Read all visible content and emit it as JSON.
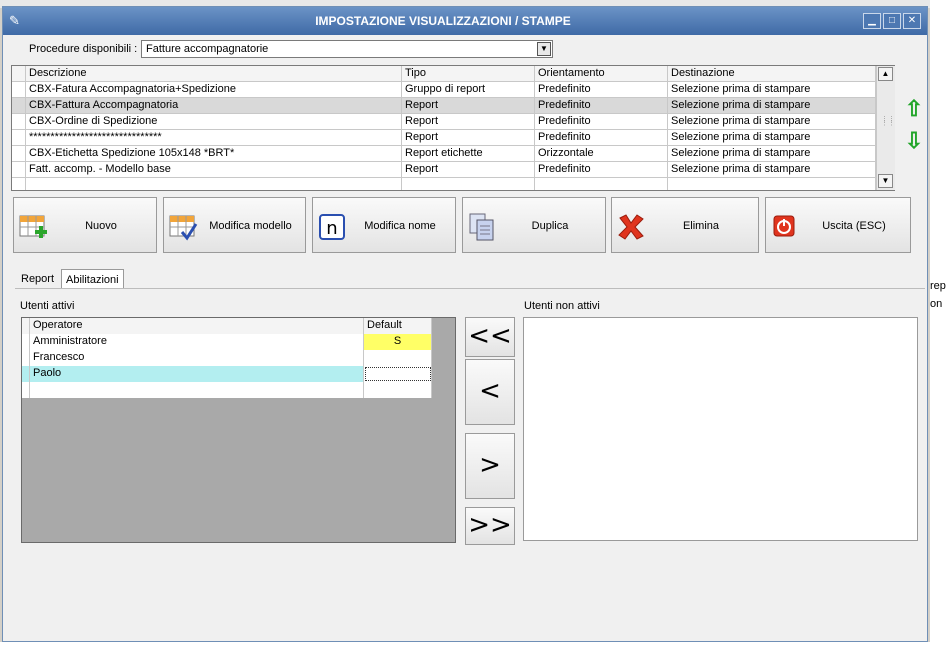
{
  "window": {
    "title": "IMPOSTAZIONE VISUALIZZAZIONI / STAMPE"
  },
  "procedure": {
    "label": "Procedure disponibili :",
    "value": "Fatture accompagnatorie"
  },
  "reports": {
    "columns": [
      "Descrizione",
      "Tipo",
      "Orientamento",
      "Destinazione"
    ],
    "rows": [
      [
        "CBX-Fatura Accompagnatoria+Spedizione",
        "Gruppo di report",
        "Predefinito",
        "Selezione prima di stampare"
      ],
      [
        "CBX-Fattura Accompagnatoria",
        "Report",
        "Predefinito",
        "Selezione prima di stampare"
      ],
      [
        "CBX-Ordine di Spedizione",
        "Report",
        "Predefinito",
        "Selezione prima di stampare"
      ],
      [
        "*******************************",
        "Report",
        "Predefinito",
        "Selezione prima di stampare"
      ],
      [
        "CBX-Etichetta Spedizione 105x148 *BRT*",
        "Report etichette",
        "Orizzontale",
        "Selezione prima di stampare"
      ],
      [
        "Fatt. accomp. - Modello base",
        "Report",
        "Predefinito",
        "Selezione prima di stampare"
      ]
    ]
  },
  "toolbar": {
    "nuovo": "Nuovo",
    "modifica_modello": "Modifica modello",
    "modifica_nome": "Modifica nome",
    "duplica": "Duplica",
    "elimina": "Elimina",
    "uscita": "Uscita (ESC)"
  },
  "tabs": [
    "Report",
    "Abilitazioni"
  ],
  "users": {
    "active_label": "Utenti attivi",
    "inactive_label": "Utenti non attivi",
    "columns": [
      "Operatore",
      "Default"
    ],
    "rows": [
      [
        "Amministratore",
        "S"
      ],
      [
        "Francesco",
        ""
      ],
      [
        "Paolo",
        ""
      ]
    ]
  },
  "move_buttons": {
    "all_left": "<<",
    "left": "<",
    "right": ">",
    "all_right": ">>"
  },
  "background_text": {
    "line1": "rep",
    "line2": "on"
  },
  "colors": {
    "titlebar": "#4f7bb5",
    "selected_row": "#b3eef0",
    "highlight": "#ffff66"
  }
}
